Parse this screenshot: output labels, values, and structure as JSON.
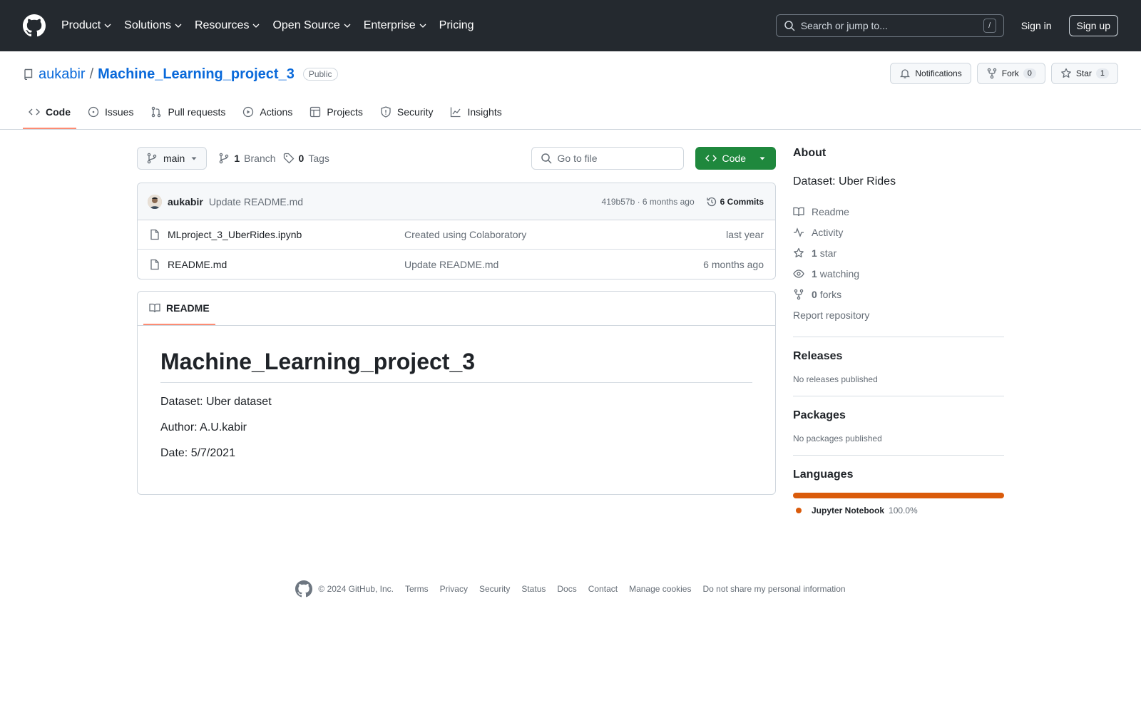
{
  "header": {
    "nav": [
      "Product",
      "Solutions",
      "Resources",
      "Open Source",
      "Enterprise",
      "Pricing"
    ],
    "search_placeholder": "Search or jump to...",
    "search_shortcut": "/",
    "sign_in": "Sign in",
    "sign_up": "Sign up"
  },
  "repo": {
    "owner": "aukabir",
    "separator": "/",
    "name": "Machine_Learning_project_3",
    "visibility": "Public",
    "notifications_label": "Notifications",
    "fork_label": "Fork",
    "fork_count": "0",
    "star_label": "Star",
    "star_count": "1"
  },
  "tabs": [
    "Code",
    "Issues",
    "Pull requests",
    "Actions",
    "Projects",
    "Security",
    "Insights"
  ],
  "toolbar": {
    "branch": "main",
    "branch_count": "1",
    "branch_label": "Branch",
    "tag_count": "0",
    "tag_label": "Tags",
    "go_to_file": "Go to file",
    "code_button": "Code"
  },
  "commit": {
    "author": "aukabir",
    "message": "Update README.md",
    "sha_time": "419b57b · 6 months ago",
    "commits": "6 Commits"
  },
  "files": [
    {
      "name": "MLproject_3_UberRides.ipynb",
      "message": "Created using Colaboratory",
      "date": "last year"
    },
    {
      "name": "README.md",
      "message": "Update README.md",
      "date": "6 months ago"
    }
  ],
  "readme": {
    "tab_label": "README",
    "title": "Machine_Learning_project_3",
    "lines": [
      "Dataset: Uber dataset",
      "Author: A.U.kabir",
      "Date: 5/7/2021"
    ]
  },
  "about": {
    "heading": "About",
    "description": "Dataset: Uber Rides",
    "readme": "Readme",
    "activity": "Activity",
    "stars_count": "1",
    "stars_label": "star",
    "watching_count": "1",
    "watching_label": "watching",
    "forks_count": "0",
    "forks_label": "forks",
    "report": "Report repository"
  },
  "releases": {
    "heading": "Releases",
    "text": "No releases published"
  },
  "packages": {
    "heading": "Packages",
    "text": "No packages published"
  },
  "languages": {
    "heading": "Languages",
    "name": "Jupyter Notebook",
    "percent": "100.0%",
    "share": 1.0,
    "color": "#da5b0b"
  },
  "footer": {
    "copyright": "© 2024 GitHub, Inc.",
    "links": [
      "Terms",
      "Privacy",
      "Security",
      "Status",
      "Docs",
      "Contact",
      "Manage cookies",
      "Do not share my personal information"
    ]
  },
  "colors": {
    "accent_link": "#0969da",
    "code_button": "#1f883d",
    "active_tab": "#fd8c73",
    "header_bg": "#24292f"
  }
}
